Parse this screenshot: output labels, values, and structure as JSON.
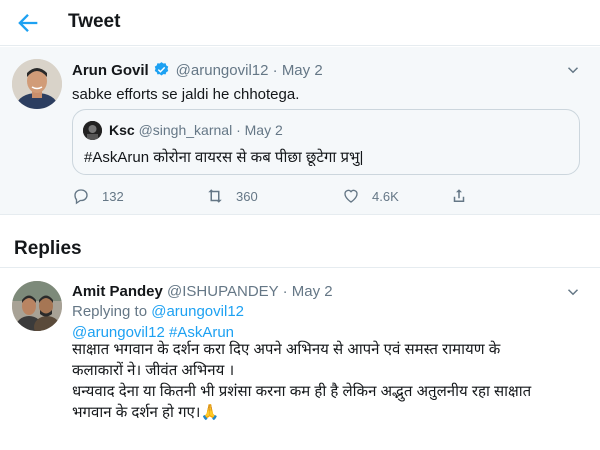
{
  "header": {
    "title": "Tweet"
  },
  "main_tweet": {
    "name": "Arun Govil",
    "handle": "@arungovil12",
    "date": "May 2",
    "text": "sabke efforts se jaldi he chhotega.",
    "quote": {
      "name": "Ksc",
      "handle": "@singh_karnal",
      "date": "May 2",
      "text": "#AskArun  कोरोना वायरस से कब पीछा छूटेगा प्रभु|"
    },
    "stats": {
      "replies": "132",
      "retweets": "360",
      "likes": "4.6K"
    }
  },
  "replies_section": {
    "title": "Replies"
  },
  "reply": {
    "name": "Amit Pandey",
    "handle": "@ISHUPANDEY",
    "date": "May 2",
    "replying_to_prefix": "Replying to",
    "replying_to_handle": "@arungovil12",
    "mention_handle": "@arungovil12",
    "mention_hashtag": "#AskArun",
    "paragraph1": "साक्षात भगवान के दर्शन करा दिए अपने अभिनय से आपने एवं समस्त रामायण के कलाकारों ने। जीवंत अभिनय ।",
    "paragraph2": "धन्यवाद देना या कितनी भी प्रशंसा करना कम ही है लेकिन अद्भुत अतुलनीय रहा साक्षात भगवान के दर्शन हो गए।",
    "emoji": "🙏"
  },
  "colors": {
    "accent": "#1da1f2",
    "muted": "#657786",
    "text": "#14171a",
    "background_highlight": "#f5f8fa",
    "border": "#e6ecf0"
  },
  "icons": [
    "back-arrow-icon",
    "verified-badge-icon",
    "chevron-down-icon",
    "reply-icon",
    "retweet-icon",
    "like-icon",
    "share-icon"
  ]
}
